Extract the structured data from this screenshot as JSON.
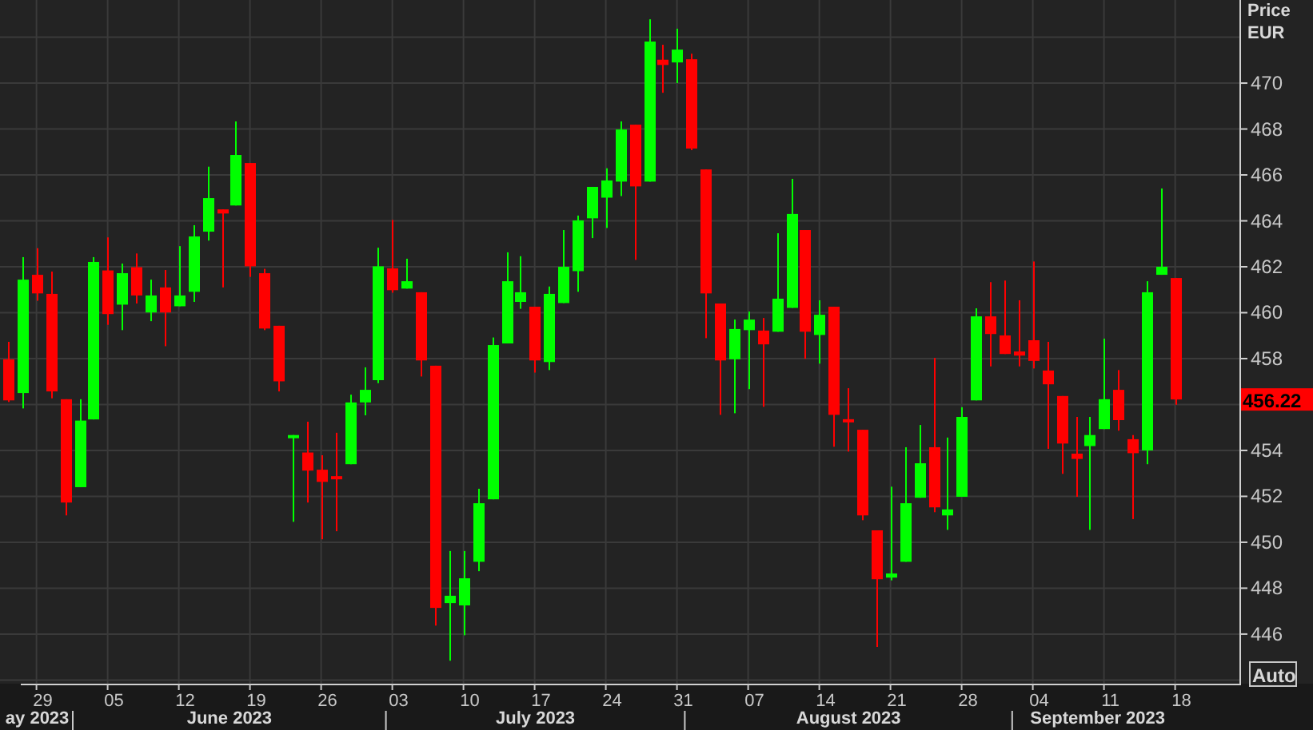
{
  "chart": {
    "axis_title": "Price",
    "currency": "EUR",
    "last_price": "456.22",
    "auto_button": "Auto",
    "months": [
      {
        "label": "ay 2023"
      },
      {
        "label": "June 2023"
      },
      {
        "label": "July 2023"
      },
      {
        "label": "August 2023"
      },
      {
        "label": "September 2023"
      }
    ],
    "chart_data": {
      "type": "candlestick",
      "grid": true,
      "ylim": [
        443.84,
        473.62
      ],
      "yticks": [
        446,
        448,
        450,
        452,
        454,
        458,
        460,
        462,
        464,
        466,
        468,
        470
      ],
      "categories": [
        null,
        null,
        "29",
        null,
        null,
        null,
        null,
        "05",
        null,
        null,
        null,
        null,
        "12",
        null,
        null,
        null,
        null,
        "19",
        null,
        null,
        null,
        null,
        "26",
        null,
        null,
        null,
        null,
        "03",
        null,
        null,
        null,
        null,
        "10",
        null,
        null,
        null,
        null,
        "17",
        null,
        null,
        null,
        null,
        "24",
        null,
        null,
        null,
        null,
        "31",
        null,
        null,
        null,
        null,
        "07",
        null,
        null,
        null,
        null,
        "14",
        null,
        null,
        null,
        null,
        "21",
        null,
        null,
        null,
        null,
        "28",
        null,
        null,
        null,
        null,
        "04",
        null,
        null,
        null,
        null,
        "11",
        null,
        null,
        null,
        null,
        "18"
      ],
      "ohlc": [
        [
          457.97,
          458.73,
          456.11,
          456.18
        ],
        [
          456.5,
          462.42,
          455.83,
          461.44
        ],
        [
          461.65,
          462.81,
          460.52,
          460.84
        ],
        [
          460.82,
          461.79,
          456.27,
          456.57
        ],
        [
          456.23,
          456.23,
          451.17,
          451.73
        ],
        [
          452.4,
          456.23,
          452.4,
          455.3
        ],
        [
          455.35,
          462.42,
          455.35,
          462.21
        ],
        [
          461.84,
          463.28,
          459.47,
          459.94
        ],
        [
          460.35,
          462.14,
          459.24,
          461.72
        ],
        [
          461.98,
          462.58,
          460.4,
          460.75
        ],
        [
          460.01,
          461.44,
          459.63,
          460.75
        ],
        [
          461.1,
          461.86,
          458.54,
          460.01
        ],
        [
          460.28,
          462.9,
          460.28,
          460.75
        ],
        [
          460.91,
          463.81,
          460.47,
          463.32
        ],
        [
          463.53,
          466.36,
          463.14,
          464.99
        ],
        [
          464.5,
          464.5,
          461.1,
          464.32
        ],
        [
          464.67,
          468.33,
          464.67,
          466.87
        ],
        [
          466.52,
          466.52,
          461.56,
          462.02
        ],
        [
          461.72,
          461.91,
          459.24,
          459.31
        ],
        [
          459.43,
          459.43,
          456.57,
          457.01
        ],
        [
          454.62,
          454.67,
          450.89,
          454.67
        ],
        [
          453.91,
          455.25,
          451.73,
          453.12
        ],
        [
          453.16,
          453.79,
          450.13,
          452.63
        ],
        [
          452.88,
          454.77,
          450.48,
          452.84
        ],
        [
          453.4,
          456.43,
          453.4,
          456.09
        ],
        [
          456.09,
          457.62,
          455.53,
          456.64
        ],
        [
          457.06,
          462.83,
          456.93,
          462.02
        ],
        [
          461.93,
          464.04,
          460.87,
          460.98
        ],
        [
          461.05,
          462.35,
          461.05,
          461.37
        ],
        [
          460.89,
          460.89,
          457.22,
          457.92
        ],
        [
          457.69,
          457.69,
          446.37,
          447.14
        ],
        [
          447.35,
          449.62,
          444.84,
          447.67
        ],
        [
          447.25,
          449.62,
          445.95,
          448.43
        ],
        [
          449.15,
          452.33,
          448.74,
          451.7
        ],
        [
          451.87,
          458.92,
          451.87,
          458.59
        ],
        [
          458.66,
          462.63,
          458.66,
          461.37
        ],
        [
          460.47,
          462.46,
          460.17,
          460.89
        ],
        [
          460.26,
          460.26,
          457.39,
          457.92
        ],
        [
          457.85,
          461.14,
          457.5,
          460.82
        ],
        [
          460.42,
          463.6,
          460.42,
          462.0
        ],
        [
          461.81,
          464.23,
          460.91,
          464.02
        ],
        [
          464.11,
          465.48,
          463.25,
          465.48
        ],
        [
          465.01,
          466.29,
          463.69,
          465.76
        ],
        [
          465.71,
          468.33,
          465.08,
          467.98
        ],
        [
          468.19,
          468.19,
          462.3,
          465.5
        ],
        [
          465.71,
          472.78,
          465.71,
          471.81
        ],
        [
          471.02,
          471.67,
          469.58,
          470.79
        ],
        [
          470.9,
          472.37,
          470.0,
          471.46
        ],
        [
          471.04,
          471.28,
          467.08,
          467.15
        ],
        [
          466.24,
          466.24,
          458.89,
          460.84
        ],
        [
          460.4,
          460.4,
          455.55,
          457.92
        ],
        [
          457.97,
          459.7,
          455.62,
          459.29
        ],
        [
          459.24,
          460.05,
          456.67,
          459.7
        ],
        [
          459.22,
          459.77,
          455.9,
          458.62
        ],
        [
          459.17,
          463.46,
          459.17,
          460.61
        ],
        [
          460.21,
          465.83,
          460.21,
          464.3
        ],
        [
          463.6,
          463.6,
          457.99,
          459.17
        ],
        [
          459.03,
          460.54,
          457.78,
          459.91
        ],
        [
          460.26,
          460.26,
          454.16,
          455.55
        ],
        [
          455.36,
          456.71,
          453.95,
          455.32
        ],
        [
          454.9,
          454.9,
          450.96,
          451.17
        ],
        [
          450.52,
          450.52,
          445.44,
          448.39
        ],
        [
          448.46,
          452.42,
          448.34,
          448.64
        ],
        [
          449.15,
          454.14,
          449.15,
          451.7
        ],
        [
          451.94,
          455.11,
          451.94,
          453.44
        ],
        [
          454.14,
          458.03,
          451.31,
          451.52
        ],
        [
          451.17,
          454.56,
          450.54,
          451.43
        ],
        [
          451.98,
          455.88,
          451.98,
          455.46
        ],
        [
          456.18,
          460.19,
          456.18,
          459.84
        ],
        [
          459.84,
          461.33,
          457.66,
          459.07
        ],
        [
          459.01,
          461.4,
          458.2,
          458.2
        ],
        [
          458.31,
          460.54,
          457.66,
          458.13
        ],
        [
          458.8,
          462.23,
          457.57,
          457.9
        ],
        [
          457.48,
          458.73,
          454.07,
          456.88
        ],
        [
          456.37,
          456.37,
          452.98,
          454.3
        ],
        [
          453.86,
          455.46,
          451.98,
          453.63
        ],
        [
          454.19,
          455.46,
          450.54,
          454.67
        ],
        [
          454.93,
          458.87,
          454.93,
          456.23
        ],
        [
          456.64,
          457.5,
          454.86,
          455.32
        ],
        [
          454.49,
          454.67,
          451.01,
          453.88
        ],
        [
          454.0,
          461.37,
          453.4,
          460.89
        ],
        [
          461.65,
          465.41,
          461.65,
          462.0
        ],
        [
          461.51,
          461.51,
          455.99,
          456.22
        ]
      ]
    }
  }
}
